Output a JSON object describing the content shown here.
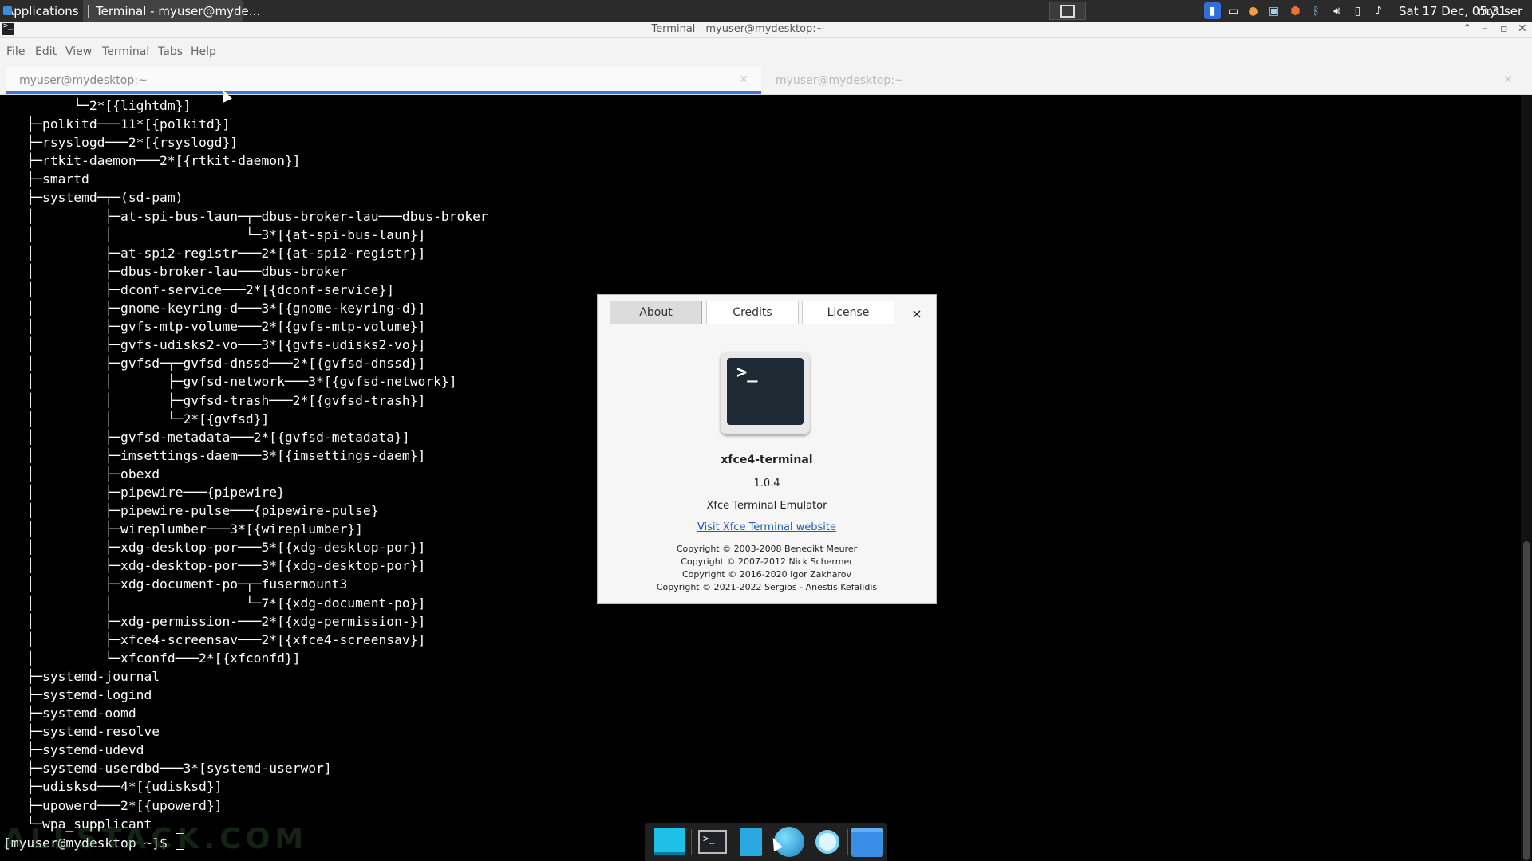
{
  "top_panel": {
    "applications_label": "Applications",
    "taskbar_window": "Terminal - myuser@myde...",
    "tray_icons": [
      "display-icon",
      "clipboard-icon",
      "firefox-icon",
      "network-icon",
      "shield-icon",
      "bluetooth-icon",
      "volume-icon",
      "battery-icon",
      "notification-icon"
    ],
    "clock": "Sat 17 Dec, 05:31",
    "user": "myuser"
  },
  "window": {
    "title": "Terminal - myuser@mydesktop:~"
  },
  "menu": {
    "file": "File",
    "edit": "Edit",
    "view": "View",
    "terminal": "Terminal",
    "tabs": "Tabs",
    "help": "Help"
  },
  "tabs": [
    {
      "label": "myuser@mydesktop:~",
      "active": true
    },
    {
      "label": "myuser@mydesktop:~",
      "active": false
    }
  ],
  "terminal": {
    "lines": [
      "         └─2*[{lightdm}]",
      "   ├─polkitd───11*[{polkitd}]",
      "   ├─rsyslogd───2*[{rsyslogd}]",
      "   ├─rtkit-daemon───2*[{rtkit-daemon}]",
      "   ├─smartd",
      "   ├─systemd─┬─(sd-pam)",
      "   │         ├─at-spi-bus-laun─┬─dbus-broker-lau───dbus-broker",
      "   │         │                 └─3*[{at-spi-bus-laun}]",
      "   │         ├─at-spi2-registr───2*[{at-spi2-registr}]",
      "   │         ├─dbus-broker-lau───dbus-broker",
      "   │         ├─dconf-service───2*[{dconf-service}]",
      "   │         ├─gnome-keyring-d───3*[{gnome-keyring-d}]",
      "   │         ├─gvfs-mtp-volume───2*[{gvfs-mtp-volume}]",
      "   │         ├─gvfs-udisks2-vo───3*[{gvfs-udisks2-vo}]",
      "   │         ├─gvfsd─┬─gvfsd-dnssd───2*[{gvfsd-dnssd}]",
      "   │         │       ├─gvfsd-network───3*[{gvfsd-network}]",
      "   │         │       ├─gvfsd-trash───2*[{gvfsd-trash}]",
      "   │         │       └─2*[{gvfsd}]",
      "   │         ├─gvfsd-metadata───2*[{gvfsd-metadata}]",
      "   │         ├─imsettings-daem───3*[{imsettings-daem}]",
      "   │         ├─obexd",
      "   │         ├─pipewire───{pipewire}",
      "   │         ├─pipewire-pulse───{pipewire-pulse}",
      "   │         ├─wireplumber───3*[{wireplumber}]",
      "   │         ├─xdg-desktop-por───5*[{xdg-desktop-por}]",
      "   │         ├─xdg-desktop-por───3*[{xdg-desktop-por}]",
      "   │         ├─xdg-document-po─┬─fusermount3",
      "   │         │                 └─7*[{xdg-document-po}]",
      "   │         ├─xdg-permission-───2*[{xdg-permission-}]",
      "   │         ├─xfce4-screensav───2*[{xfce4-screensav}]",
      "   │         └─xfconfd───2*[{xfconfd}]",
      "   ├─systemd-journal",
      "   ├─systemd-logind",
      "   ├─systemd-oomd",
      "   ├─systemd-resolve",
      "   ├─systemd-udevd",
      "   ├─systemd-userdbd───3*[systemd-userwor]",
      "   ├─udisksd───4*[{udisksd}]",
      "   ├─upowerd───2*[{upowerd}]",
      "   └─wpa_supplicant"
    ],
    "prompt": "[myuser@mydesktop ~]$ "
  },
  "watermark": "ALLSTACK.COM",
  "dock": {
    "items": [
      "show-desktop-icon",
      "terminal-icon",
      "file-manager-icon",
      "web-browser-icon",
      "app-finder-icon",
      "folder-icon"
    ]
  },
  "about_dialog": {
    "tabs": [
      "About",
      "Credits",
      "License"
    ],
    "close_symbol": "×",
    "logo_prompt": ">_",
    "app_name": "xfce4-terminal",
    "version": "1.0.4",
    "description": "Xfce Terminal Emulator",
    "website_link": "Visit Xfce Terminal website",
    "copyright": [
      "Copyright © 2003-2008 Benedikt Meurer",
      "Copyright © 2007-2012 Nick Schermer",
      "Copyright © 2016-2020 Igor Zakharov",
      "Copyright © 2021-2022 Sergios - Anestis Kefalidis"
    ]
  },
  "colors": {
    "panel_bg": "#2b2b2b",
    "terminal_bg": "#000000",
    "terminal_fg": "#ffffff",
    "active_tab_accent": "#3a7bd5",
    "link": "#1a5fb4"
  }
}
